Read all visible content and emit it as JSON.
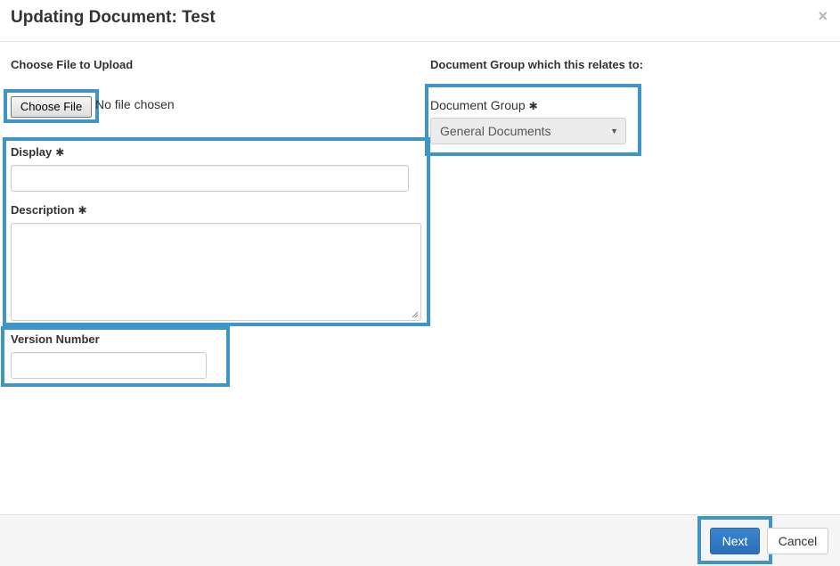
{
  "modal": {
    "title": "Updating Document: Test",
    "close_glyph": "×"
  },
  "upload": {
    "heading": "Choose File to Upload",
    "button_label": "Choose File",
    "status": "No file chosen"
  },
  "form": {
    "display_label": "Display",
    "display_value": "",
    "description_label": "Description",
    "description_value": "",
    "version_label": "Version Number",
    "version_value": "",
    "required_marker": "✱"
  },
  "document_group": {
    "heading": "Document Group which this relates to:",
    "label": "Document Group",
    "selected": "General Documents",
    "caret": "▼"
  },
  "footer": {
    "next_label": "Next",
    "cancel_label": "Cancel"
  },
  "colors": {
    "highlight": "#3d95c9",
    "primary_button": "#2a6fb7"
  }
}
